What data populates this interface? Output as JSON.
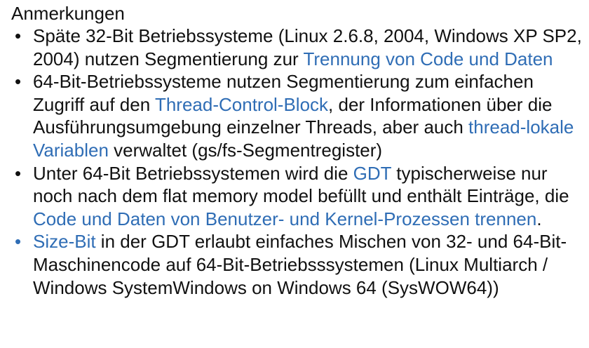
{
  "heading": "Anmerkungen",
  "colors": {
    "text": "#111111",
    "highlight": "#2f6db5"
  },
  "bullets": [
    {
      "glyph": "•",
      "glyph_highlight": false,
      "parts": [
        "Späte 32-Bit Betriebssysteme (Linux 2.6.8, 2004, Windows XP SP2, 2004) nutzen Segmentierung zur ",
        "Trennung von Code und Daten",
        ""
      ]
    },
    {
      "glyph": "•",
      "glyph_highlight": false,
      "parts": [
        "64-Bit-Betriebssysteme nutzen Segmentierung zum einfachen Zugriff auf den ",
        "Thread-Control-Block",
        ", der Informationen über die Ausführungsumgebung einzelner Threads, aber auch ",
        "thread-lokale Variablen",
        " verwaltet (gs/fs-Segmentregister)"
      ]
    },
    {
      "glyph": "•",
      "glyph_highlight": false,
      "parts": [
        "Unter 64-Bit Betriebssystemen wird die ",
        "GDT",
        " typischerweise nur noch nach dem flat memory model befüllt und enthält Einträge, die ",
        "Code und Daten von Benutzer- und Kernel-Prozessen trennen",
        "."
      ]
    },
    {
      "glyph": "•",
      "glyph_highlight": true,
      "parts": [
        "",
        "Size-Bit",
        " in der GDT erlaubt einfaches Mischen von 32- und 64-Bit-Maschinencode auf 64-Bit-Betriebsssystemen (Linux Multiarch / Windows SystemWindows on Windows 64 (SysWOW64))"
      ]
    }
  ]
}
